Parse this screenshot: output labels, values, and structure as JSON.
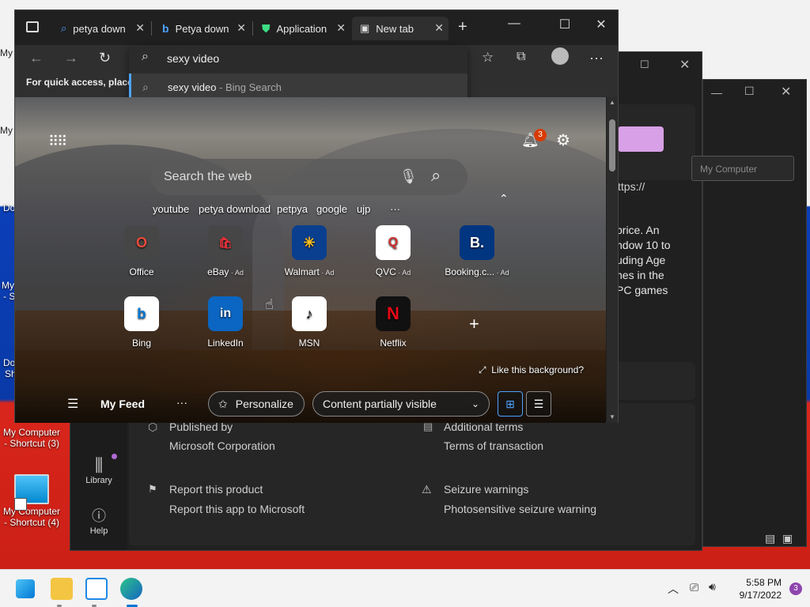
{
  "desktop": {
    "fragments": [
      "My",
      "My",
      "Do",
      "My",
      "- S",
      "Do",
      "Sh"
    ],
    "icons": [
      {
        "label_line1": "My Computer",
        "label_line2": "- Shortcut (3)"
      },
      {
        "label_line1": "My Computer",
        "label_line2": "- Shortcut (4)"
      }
    ]
  },
  "store": {
    "account_field": "My Computer",
    "url_fragment": "ttps://",
    "desc_lines": [
      "price. An",
      "ndow 10 to",
      "uding Age",
      "nes in the",
      "PC games"
    ],
    "published_by_label": "Published by",
    "published_by_value": "Microsoft Corporation",
    "additional_terms_label": "Additional terms",
    "additional_terms_value": "Terms of transaction",
    "report_label": "Report this product",
    "report_value": "Report this app to Microsoft",
    "seizure_label": "Seizure warnings",
    "seizure_value": "Photosensitive seizure warning",
    "nav": [
      {
        "label": "Library"
      },
      {
        "label": "Help"
      }
    ]
  },
  "browser": {
    "tabs": [
      {
        "label": "petya down"
      },
      {
        "label": "Petya down"
      },
      {
        "label": "Application"
      },
      {
        "label": "New tab"
      }
    ],
    "favbar_text": "For quick access, place y",
    "omnibox": {
      "value": "sexy video",
      "suggestion": "sexy video",
      "suggestion_source": " - Bing Search"
    },
    "notification_count": "3",
    "search_placeholder": "Search the web",
    "quick_links": [
      "youtube",
      "petya download",
      "petpya",
      "google",
      "ujp"
    ],
    "more_links": "···",
    "tiles_row1": [
      {
        "label": "Office",
        "ad": ""
      },
      {
        "label": "eBay",
        "ad": " · Ad"
      },
      {
        "label": "Walmart",
        "ad": " · Ad"
      },
      {
        "label": "QVC",
        "ad": " · Ad"
      },
      {
        "label": "Booking.c...",
        "ad": " · Ad"
      }
    ],
    "tiles_row2": [
      {
        "label": "Bing"
      },
      {
        "label": "LinkedIn"
      },
      {
        "label": "MSN"
      },
      {
        "label": "Netflix"
      }
    ],
    "like_background": "Like this background?",
    "feed": {
      "title": "My Feed",
      "personalize": "Personalize",
      "content_visibility": "Content partially visible"
    }
  },
  "taskbar": {
    "time": "5:58 PM",
    "date": "9/17/2022",
    "notif_badge": "3"
  }
}
